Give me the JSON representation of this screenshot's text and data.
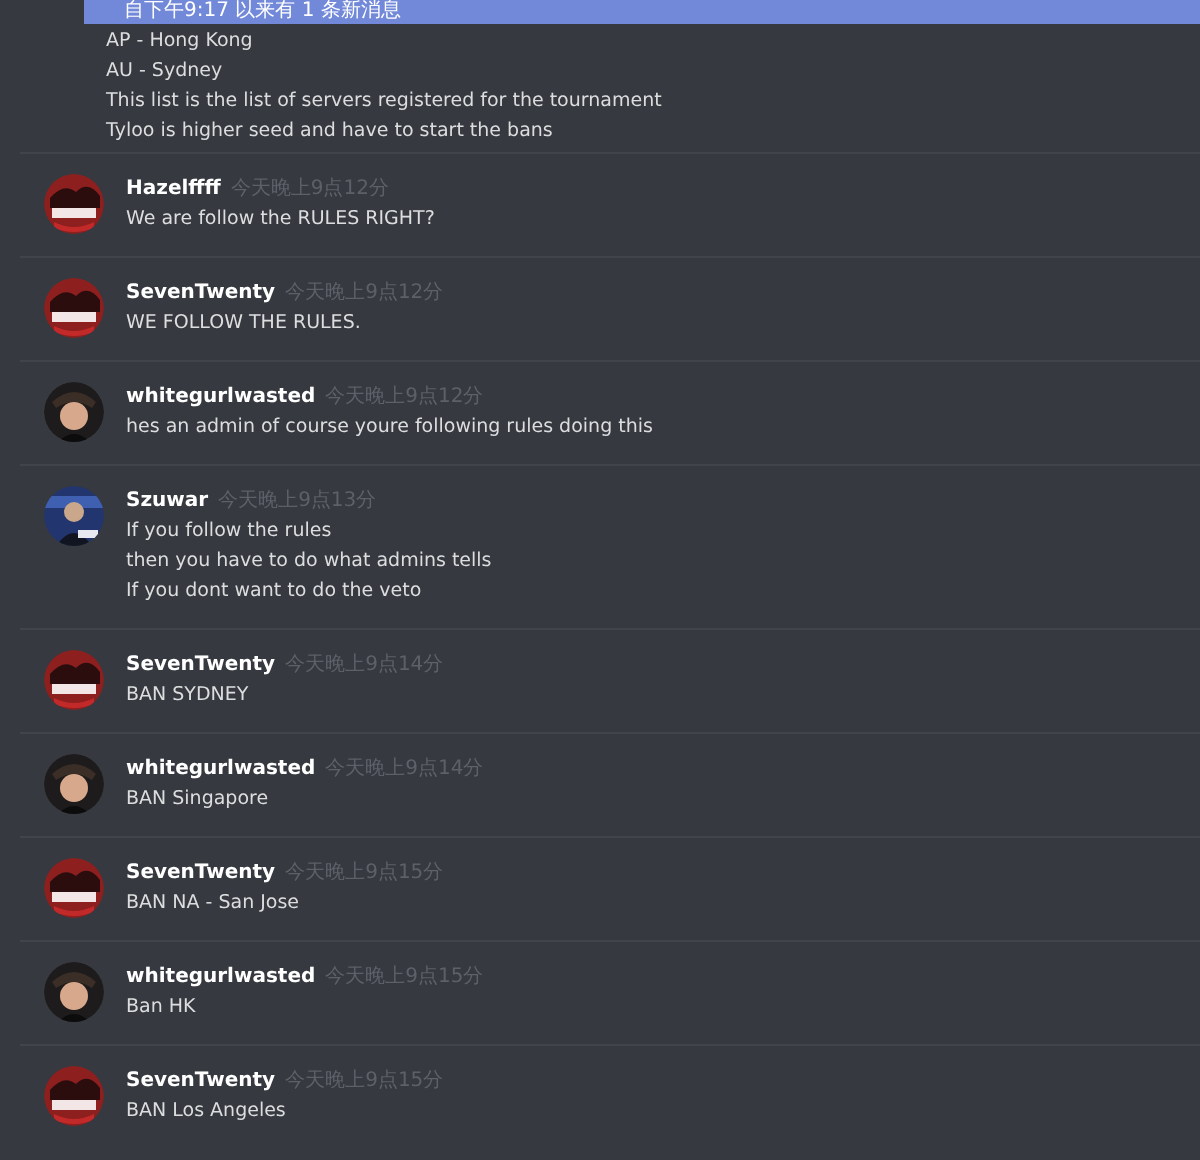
{
  "new_messages_bar": {
    "text": "自下午9:17 以来有 1 条新消息"
  },
  "messages": [
    {
      "lines": [
        "AP - Hong Kong",
        "AU - Sydney",
        "This list is the list of servers registered for the tournament",
        "Tyloo is higher seed and have to start the bans"
      ]
    },
    {
      "author": "Hazelffff",
      "avatar": {
        "kind": "team"
      },
      "time": "今天晚上9点12分",
      "lines": [
        "We are  follow  the  RULES  RIGHT?"
      ]
    },
    {
      "author": "SevenTwenty",
      "avatar": {
        "kind": "team"
      },
      "time": "今天晚上9点12分",
      "lines": [
        "WE FOLLOW THE RULES."
      ]
    },
    {
      "author": "whitegurlwasted",
      "avatar": {
        "kind": "dark"
      },
      "time": "今天晚上9点12分",
      "lines": [
        "hes an admin of course youre following rules doing this"
      ]
    },
    {
      "author": "Szuwar",
      "avatar": {
        "kind": "blue"
      },
      "time": "今天晚上9点13分",
      "lines": [
        "If you follow the rules",
        "then you have to do what admins tells",
        "If you dont want to do the veto"
      ]
    },
    {
      "author": "SevenTwenty",
      "avatar": {
        "kind": "team"
      },
      "time": "今天晚上9点14分",
      "lines": [
        "BAN SYDNEY"
      ]
    },
    {
      "author": "whitegurlwasted",
      "avatar": {
        "kind": "dark"
      },
      "time": "今天晚上9点14分",
      "lines": [
        "BAN Singapore"
      ]
    },
    {
      "author": "SevenTwenty",
      "avatar": {
        "kind": "team"
      },
      "time": "今天晚上9点15分",
      "lines": [
        "BAN NA - San Jose"
      ]
    },
    {
      "author": "whitegurlwasted",
      "avatar": {
        "kind": "dark"
      },
      "time": "今天晚上9点15分",
      "lines": [
        "Ban HK"
      ]
    },
    {
      "author": "SevenTwenty",
      "avatar": {
        "kind": "team"
      },
      "time": "今天晚上9点15分",
      "lines": [
        "BAN Los Angeles"
      ]
    }
  ]
}
